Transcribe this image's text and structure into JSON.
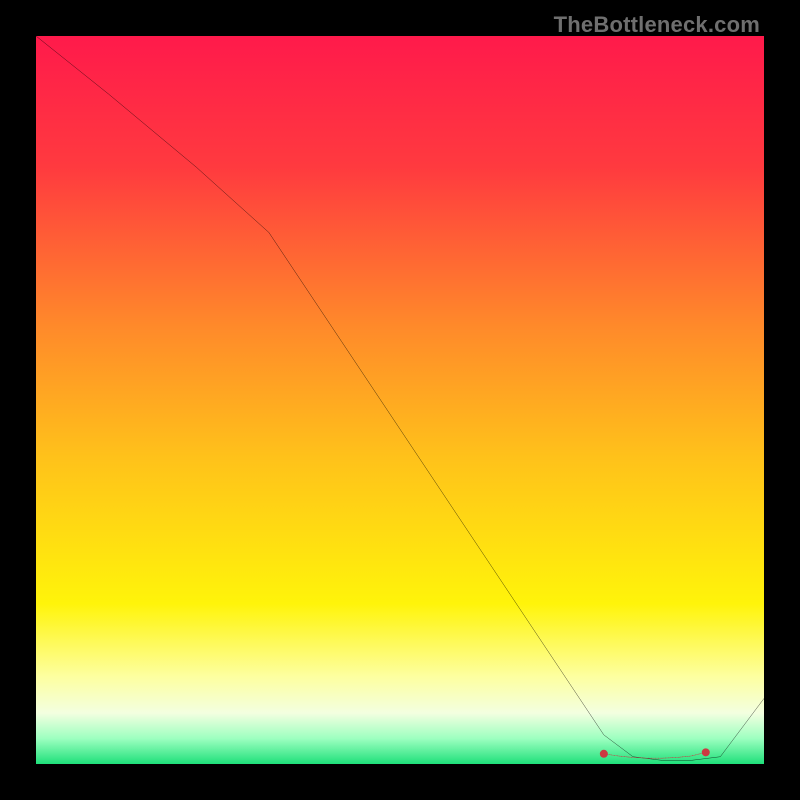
{
  "watermark": "TheBottleneck.com",
  "chart_data": {
    "type": "line",
    "title": "",
    "xlabel": "",
    "ylabel": "",
    "xlim": [
      0,
      100
    ],
    "ylim": [
      0,
      100
    ],
    "grid": false,
    "gradient_stops": [
      {
        "offset": 0.0,
        "color": "#ff1a4b"
      },
      {
        "offset": 0.18,
        "color": "#ff3a3f"
      },
      {
        "offset": 0.4,
        "color": "#ff8a2a"
      },
      {
        "offset": 0.58,
        "color": "#ffc21a"
      },
      {
        "offset": 0.78,
        "color": "#fff40a"
      },
      {
        "offset": 0.88,
        "color": "#fdffa0"
      },
      {
        "offset": 0.93,
        "color": "#f3ffe0"
      },
      {
        "offset": 0.965,
        "color": "#9dffc0"
      },
      {
        "offset": 1.0,
        "color": "#1fe07a"
      }
    ],
    "series": [
      {
        "name": "bottleneck-curve",
        "color": "#000000",
        "x": [
          0,
          10,
          22,
          32,
          42,
          52,
          62,
          72,
          78,
          82,
          86,
          90,
          94,
          100
        ],
        "y": [
          100,
          92,
          82,
          73,
          58,
          43,
          28,
          13,
          4,
          1,
          0.5,
          0.5,
          1,
          9
        ]
      }
    ],
    "optimal_marker": {
      "name": "optimal-range",
      "color": "#cc3a42",
      "x": [
        78,
        80,
        82,
        84,
        86,
        88,
        90,
        92
      ],
      "y": [
        1.4,
        1.1,
        0.9,
        0.8,
        0.8,
        0.9,
        1.1,
        1.6
      ]
    }
  }
}
